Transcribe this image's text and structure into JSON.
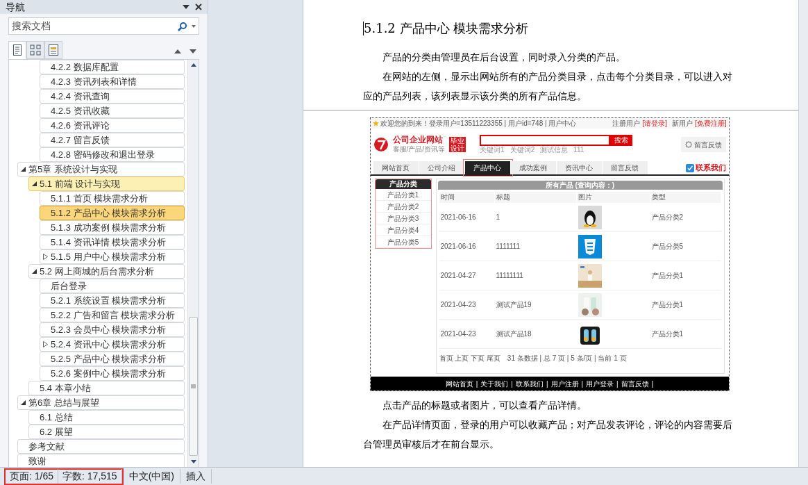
{
  "nav_pane": {
    "title": "导航",
    "search": {
      "placeholder": "搜索文档"
    },
    "view_tabs": [
      {
        "selected": true
      },
      {
        "selected": false
      },
      {
        "selected": false
      }
    ],
    "outline": {
      "continued_items": [
        {
          "label": "4.2.2 数据库配置",
          "selected": false
        },
        {
          "label": "4.2.3 资讯列表和详情",
          "selected": false
        },
        {
          "label": "4.2.4 资讯查询",
          "selected": false
        },
        {
          "label": "4.2.5 资讯收藏",
          "selected": false
        },
        {
          "label": "4.2.6 资讯评论",
          "selected": false
        },
        {
          "label": "4.2.7 留言反馈",
          "selected": false
        },
        {
          "label": "4.2.8 密码修改和退出登录",
          "selected": false
        }
      ],
      "items": [
        {
          "label": "第5章 系统设计与实现",
          "selected": false,
          "expanded": true,
          "children": [
            {
              "label": "5.1 前端 设计与实现",
              "selected": false,
              "expanded": true,
              "children": [
                {
                  "label": "5.1.1 首页 模块需求分析",
                  "selected": false
                },
                {
                  "label": "5.1.2 产品中心 模块需求分析",
                  "selected": true
                },
                {
                  "label": "5.1.3 成功案例 模块需求分析",
                  "selected": false
                },
                {
                  "label": "5.1.4 资讯详情 模块需求分析",
                  "selected": false
                },
                {
                  "label": "5.1.5 用户中心 模块需求分析",
                  "selected": false,
                  "expanded": false
                }
              ]
            },
            {
              "label": "5.2 网上商城的后台需求分析",
              "selected": false,
              "expanded": true,
              "children": [
                {
                  "label": "后台登录",
                  "selected": false
                },
                {
                  "label": "5.2.1 系统设置 模块需求分析",
                  "selected": false
                },
                {
                  "label": "5.2.2 广告和留言 模块需求分析",
                  "selected": false
                },
                {
                  "label": "5.2.3 会员中心 模块需求分析",
                  "selected": false
                },
                {
                  "label": "5.2.4 资讯中心 模块需求分析",
                  "selected": false,
                  "expanded": false
                },
                {
                  "label": "5.2.5 产品中心 模块需求分析",
                  "selected": false
                },
                {
                  "label": "5.2.6  案例中心 模块需求分析",
                  "selected": false
                }
              ]
            },
            {
              "label": "5.4 本章小结",
              "selected": false
            }
          ]
        },
        {
          "label": "第6章 总结与展望",
          "selected": false,
          "expanded": true,
          "children": [
            {
              "label": "6.1 总结",
              "selected": false
            },
            {
              "label": "6.2 展望",
              "selected": false
            }
          ]
        },
        {
          "label": "参考文献",
          "selected": false
        },
        {
          "label": "致谢",
          "selected": false
        }
      ]
    }
  },
  "document": {
    "heading": "5.1.2 产品中心 模块需求分析",
    "paragraphs_before": [
      "产品的分类由管理员在后台设置，同时录入分类的产品。",
      "在网站的左侧，显示出网站所有的产品分类目录，点击每个分类目录，可以进入对应的产品列表，该列表显示该分类的所有产品信息。"
    ],
    "figure": {
      "topbar": {
        "welcome": "欢迎您的到来！登录用户=13511223355 | 用户id=748 | 用户中心",
        "login_label": "注册用户",
        "login_link": "[请登录]",
        "register_label": "新用户",
        "register_link": "[免费注册]"
      },
      "logo": {
        "name": "公司企业网站",
        "tagline": "客服/产品/资讯等",
        "badge": "毕业设计"
      },
      "search_button": "搜索",
      "keywords": [
        "关键词1",
        "关键词2",
        "测试信息",
        "111"
      ],
      "feedback_button": "留言反馈",
      "nav": [
        {
          "label": "网站首页",
          "selected": false
        },
        {
          "label": "公司介绍",
          "selected": false
        },
        {
          "label": "产品中心",
          "selected": true
        },
        {
          "label": "成功案例",
          "selected": false
        },
        {
          "label": "资讯中心",
          "selected": false
        },
        {
          "label": "留言反馈",
          "selected": false
        }
      ],
      "contact": "联系我们",
      "sidebar": {
        "title": "产品分类",
        "annotated": true,
        "items": [
          "产品分类1",
          "产品分类2",
          "产品分类3",
          "产品分类4",
          "产品分类5"
        ]
      },
      "table": {
        "title": "所有产品 (查询内容：)",
        "columns": [
          "时间",
          "标题",
          "图片",
          "类型"
        ],
        "rows": [
          {
            "date": "2021-06-16",
            "title": "1",
            "type": "产品分类2"
          },
          {
            "date": "2021-06-16",
            "title": "1111111",
            "type": "产品分类5"
          },
          {
            "date": "2021-04-27",
            "title": "11111111",
            "type": "产品分类1"
          },
          {
            "date": "2021-04-23",
            "title": "测试产品19",
            "type": "产品分类1"
          },
          {
            "date": "2021-04-23",
            "title": "测试产品18",
            "type": "产品分类1"
          }
        ]
      },
      "pagination": {
        "links": "首页 上页 下页 尾页",
        "summary": "31 条数据 | 总 7 页 | 5 条/页 | 当前 1 页"
      },
      "footer_links": [
        "网站首页",
        "关于我们",
        "联系我们",
        "用户注册",
        "用户登录",
        "留言反馈"
      ],
      "footer_separator": "|"
    },
    "paragraphs_after": [
      "点击产品的标题或者图片，可以查看产品详情。",
      "在产品详情页面，登录的用户可以收藏产品；对产品发表评论，评论的内容需要后台管理员审核后才在前台显示。"
    ]
  },
  "status_bar": {
    "framed_group": {
      "outlined": true,
      "items": [
        "页面: 1/65",
        "字数: 17,515"
      ]
    },
    "items": [
      "中文(中国)",
      "插入"
    ]
  }
}
